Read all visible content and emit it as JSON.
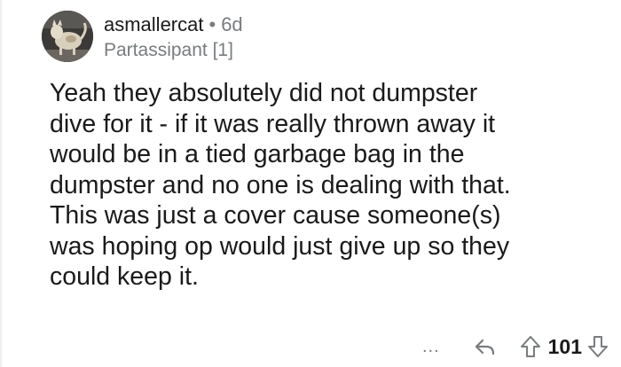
{
  "comment": {
    "username": "asmallercat",
    "separator": "•",
    "age": "6d",
    "flair": "Partassipant [1]",
    "body_lines": [
      "Yeah they absolutely did not dumpster",
      "dive for it - if it was really thrown away it",
      "would be in a tied garbage bag in the",
      "dumpster and no one is dealing with that.",
      "This was just a cover cause someone(s)",
      "was hoping op would just give up so they",
      "could keep it."
    ]
  },
  "actions": {
    "more_label": "...",
    "score": "101"
  },
  "icons": {
    "reply": "reply-icon",
    "upvote": "upvote-arrow-icon",
    "downvote": "downvote-arrow-icon",
    "more": "more-options-icon"
  },
  "colors": {
    "text": "#1a1a1b",
    "meta": "#787c7e",
    "thread_line": "#edeff1"
  }
}
